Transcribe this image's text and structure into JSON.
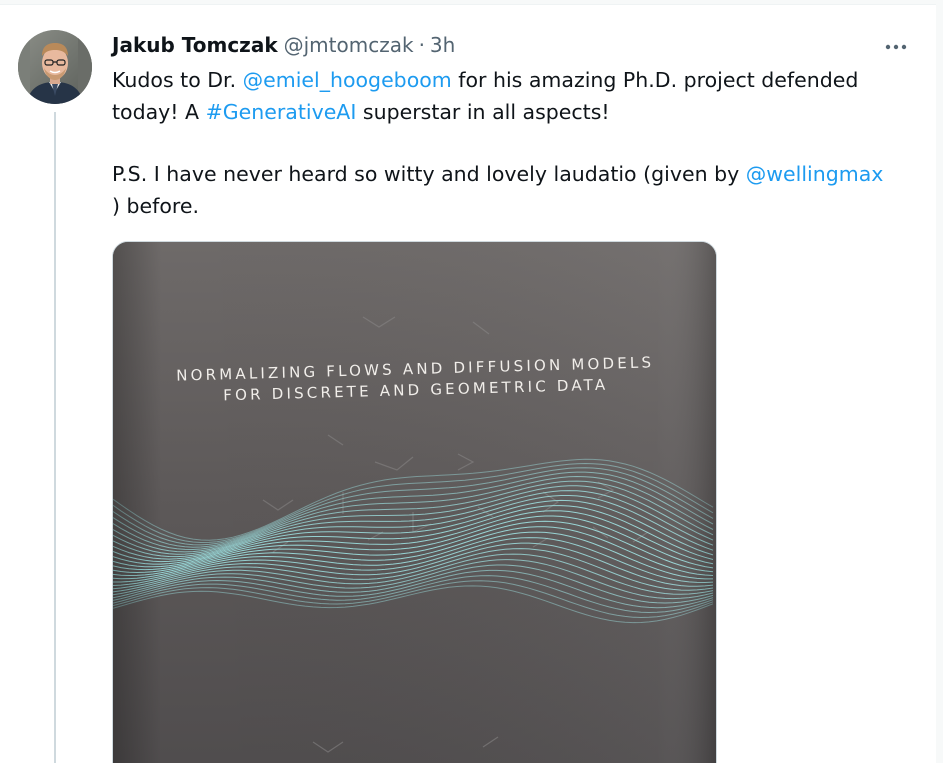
{
  "tweet": {
    "author_name": "Jakub Tomczak",
    "author_handle": "@jmtomczak",
    "separator": "·",
    "time": "3h",
    "more_label": "•••",
    "text": {
      "p1_prefix": "Kudos to Dr. ",
      "p1_mention": "@emiel_hoogeboom",
      "p1_middle": " for his amazing Ph.D. project defended today! A ",
      "p1_hashtag": "#GenerativeAI",
      "p1_suffix": " superstar in all aspects!",
      "p2_prefix": "P.S. I have never heard so witty and lovely laudatio (given by ",
      "p2_mention": "@wellingmax",
      "p2_suffix": ") before."
    },
    "media": {
      "book_title_line1": "NORMALIZING FLOWS AND DIFFUSION MODELS",
      "book_title_line2": "FOR DISCRETE AND GEOMETRIC DATA"
    }
  },
  "colors": {
    "link": "#1d9bf0",
    "secondary_text": "#536471",
    "wave": "#9ee3e3",
    "cover": "#5f5b5a"
  },
  "icons": {
    "more": "more-horizontal-icon"
  }
}
